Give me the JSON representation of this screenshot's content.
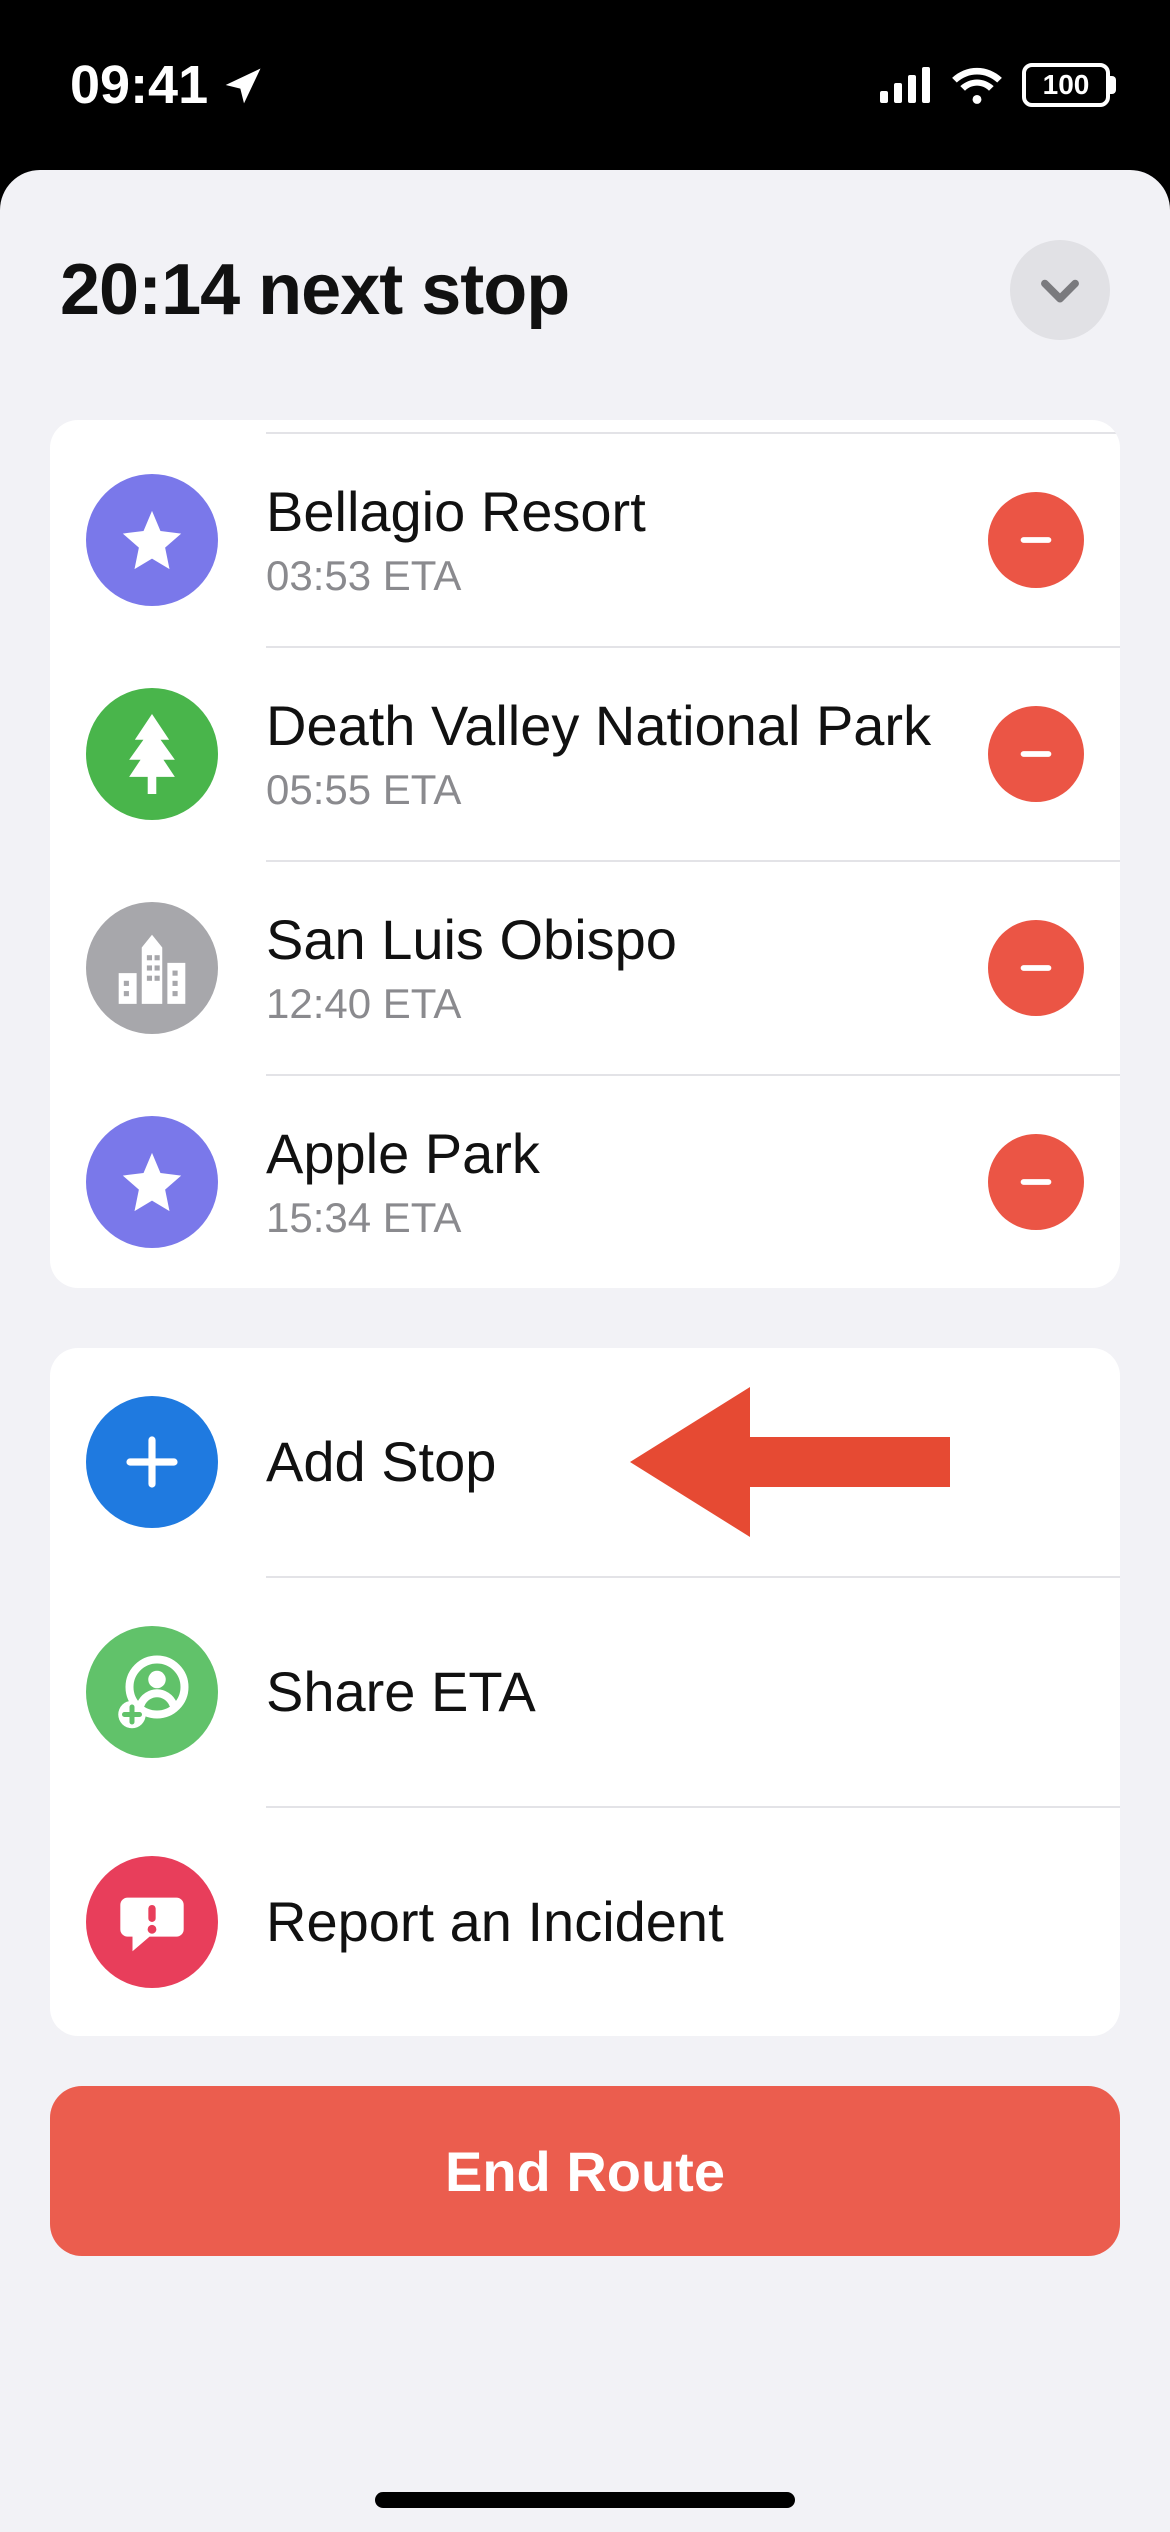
{
  "status": {
    "time": "09:41",
    "battery": "100"
  },
  "header": {
    "title": "20:14 next stop"
  },
  "stops": [
    {
      "name": "Bellagio Resort",
      "eta": "03:53 ETA",
      "icon": "star",
      "color": "purple"
    },
    {
      "name": "Death Valley National Park",
      "eta": "05:55 ETA",
      "icon": "tree",
      "color": "green"
    },
    {
      "name": "San Luis Obispo",
      "eta": "12:40 ETA",
      "icon": "city",
      "color": "grey"
    },
    {
      "name": "Apple Park",
      "eta": "15:34 ETA",
      "icon": "star",
      "color": "purple"
    }
  ],
  "actions": {
    "add_stop": "Add Stop",
    "share_eta": "Share ETA",
    "report_incident": "Report an Incident"
  },
  "end_route": "End Route",
  "colors": {
    "accent_red": "#eb5545",
    "end_route_bg": "#eb5d4e",
    "sheet_bg": "#f2f2f6"
  }
}
